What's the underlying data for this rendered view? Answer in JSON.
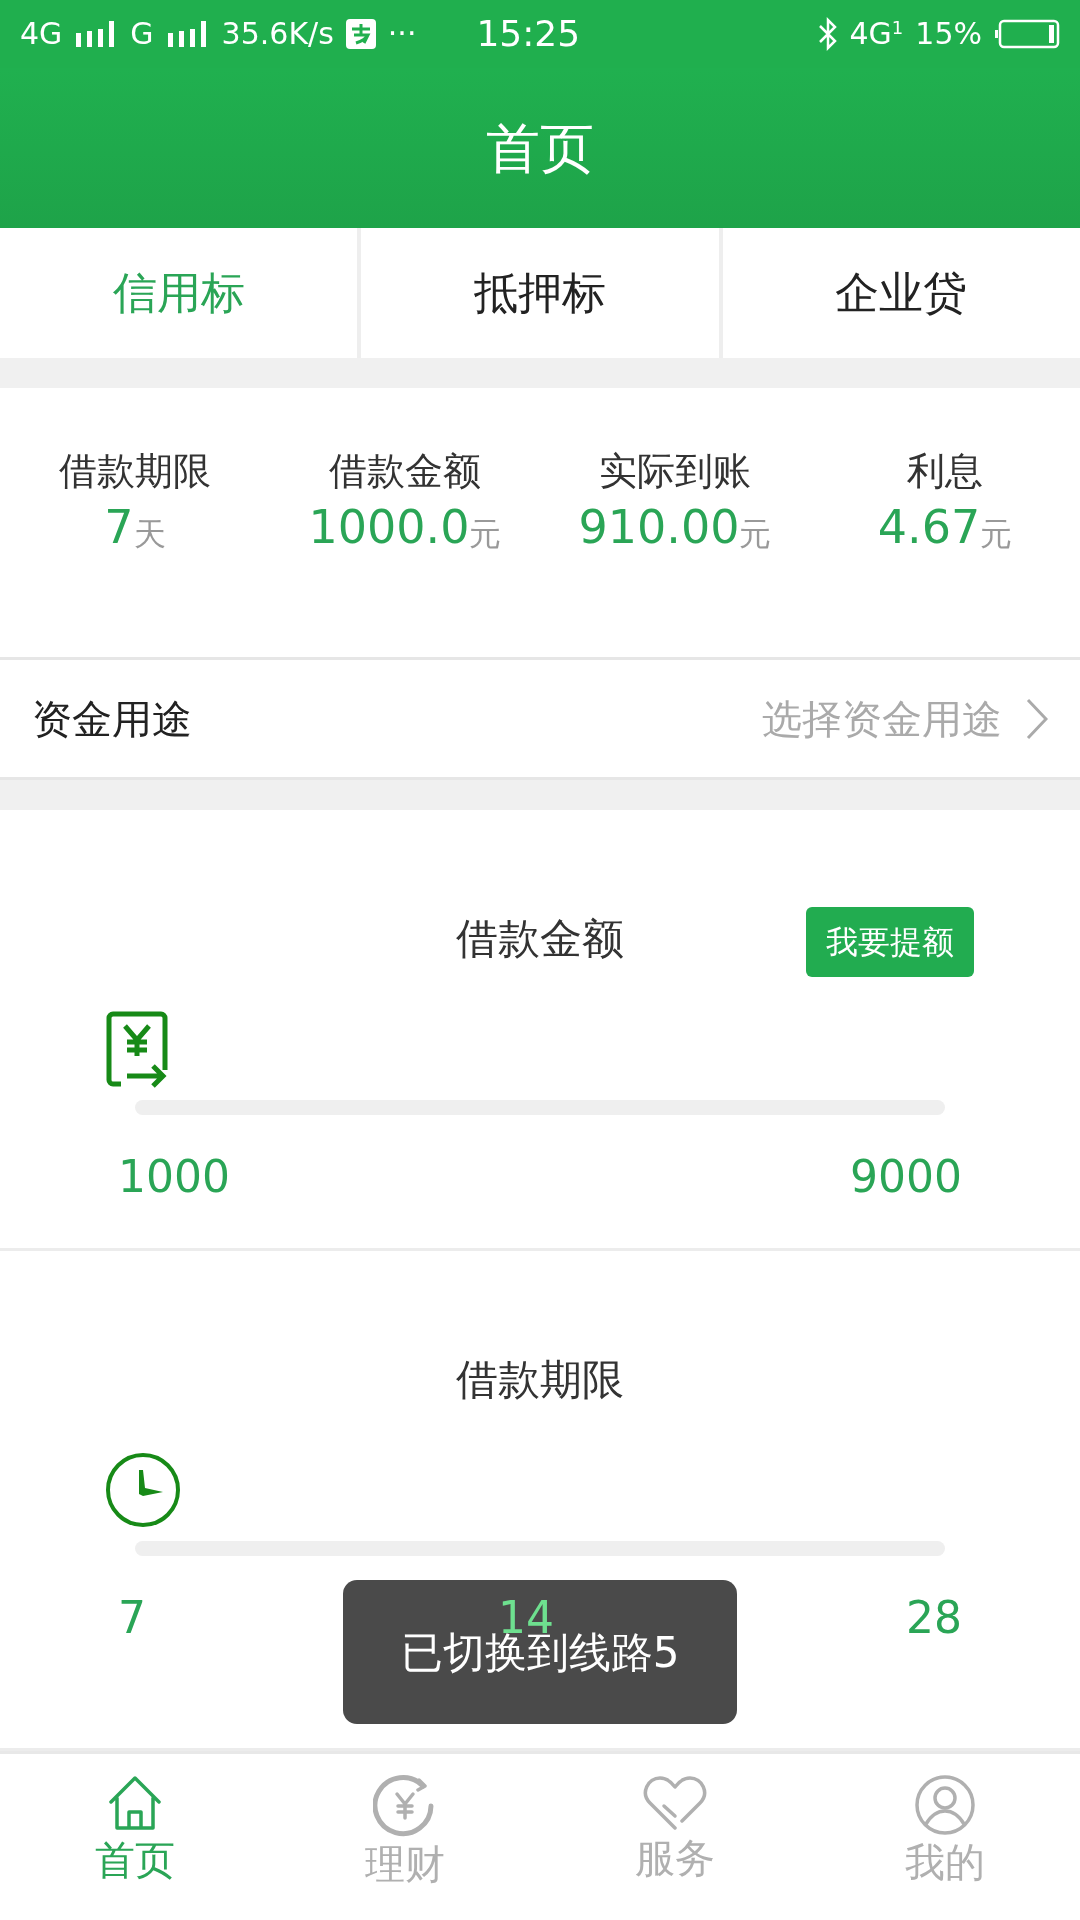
{
  "status_bar": {
    "network_1": "4G",
    "network_2": "G",
    "speed": "35.6K/s",
    "more": "···",
    "time": "15:25",
    "network_3": "4G",
    "sim": "1",
    "battery": "15%"
  },
  "header": {
    "title": "首页"
  },
  "tabs": [
    {
      "label": "信用标",
      "selected": true
    },
    {
      "label": "抵押标",
      "selected": false
    },
    {
      "label": "企业贷",
      "selected": false
    }
  ],
  "summary": [
    {
      "label": "借款期限",
      "value": "7",
      "unit": "天"
    },
    {
      "label": "借款金额",
      "value": "1000.0",
      "unit": "元"
    },
    {
      "label": "实际到账",
      "value": "910.00",
      "unit": "元"
    },
    {
      "label": "利息",
      "value": "4.67",
      "unit": "元"
    }
  ],
  "purpose": {
    "label": "资金用途",
    "placeholder": "选择资金用途"
  },
  "sliders": [
    {
      "kind": "amount",
      "title": "借款金额",
      "button": "我要提额",
      "ticks": [
        "1000",
        "9000"
      ]
    },
    {
      "kind": "term",
      "title": "借款期限",
      "ticks": [
        "7",
        "14",
        "28"
      ]
    }
  ],
  "toast": "已切换到线路5",
  "bottom_nav": [
    {
      "kind": "home",
      "label": "首页",
      "selected": true
    },
    {
      "kind": "finance",
      "label": "理财",
      "selected": false
    },
    {
      "kind": "service",
      "label": "服务",
      "selected": false
    },
    {
      "kind": "profile",
      "label": "我的",
      "selected": false
    }
  ]
}
